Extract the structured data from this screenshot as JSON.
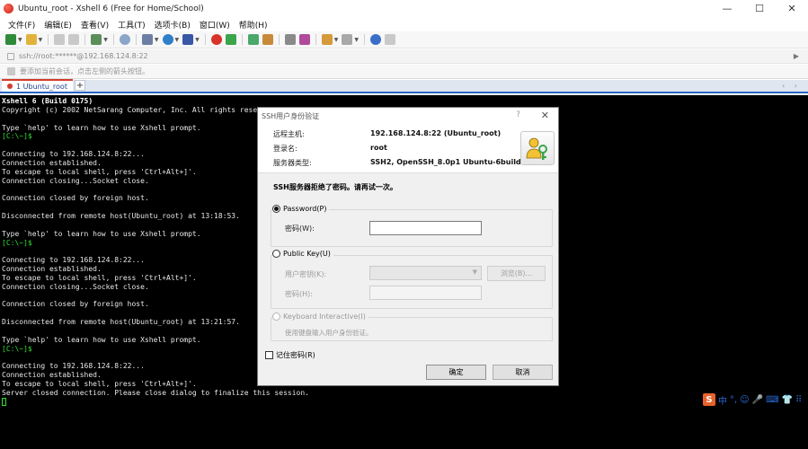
{
  "window": {
    "title": "Ubuntu_root - Xshell 6 (Free for Home/School)",
    "controls": {
      "minimize": "—",
      "maximize": "☐",
      "close": "✕"
    }
  },
  "menu": [
    "文件(F)",
    "编辑(E)",
    "查看(V)",
    "工具(T)",
    "选项卡(B)",
    "窗口(W)",
    "帮助(H)"
  ],
  "toolbar": {
    "icons": [
      "new-session-icon",
      "open-folder-icon",
      "link-icon",
      "disconnect-icon",
      "reconnect-icon",
      "search-icon",
      "properties-icon",
      "globe-icon",
      "color-icon",
      "xftp-icon",
      "xmanager-icon",
      "lock-icon",
      "keyboard-icon",
      "pen-icon",
      "script-icon",
      "layout-icon",
      "help-icon",
      "chat-icon"
    ]
  },
  "address": {
    "value": "ssh://root:******@192.168.124.8:22"
  },
  "hint": {
    "text": "要添加当前会话，点击左侧的箭头按钮。"
  },
  "tabs": [
    {
      "label": "1 Ubuntu_root",
      "active": true
    }
  ],
  "tab_add": "+",
  "tab_nav": "‹ ›",
  "terminal": {
    "lines": [
      {
        "text": "Xshell 6 (Build 0175)",
        "style": "bold"
      },
      {
        "text": "Copyright (c) 2002 NetSarang Computer, Inc. All rights reserved.",
        "style": "normal"
      },
      {
        "text": "",
        "style": "normal"
      },
      {
        "text": "Type `help' to learn how to use Xshell prompt.",
        "style": "normal"
      },
      {
        "text": "[C:\\~]$",
        "style": "prompt"
      },
      {
        "text": "",
        "style": "normal"
      },
      {
        "text": "Connecting to 192.168.124.8:22...",
        "style": "normal"
      },
      {
        "text": "Connection established.",
        "style": "normal"
      },
      {
        "text": "To escape to local shell, press 'Ctrl+Alt+]'.",
        "style": "normal"
      },
      {
        "text": "Connection closing...Socket close.",
        "style": "normal"
      },
      {
        "text": "",
        "style": "normal"
      },
      {
        "text": "Connection closed by foreign host.",
        "style": "normal"
      },
      {
        "text": "",
        "style": "normal"
      },
      {
        "text": "Disconnected from remote host(Ubuntu_root) at 13:18:53.",
        "style": "normal"
      },
      {
        "text": "",
        "style": "normal"
      },
      {
        "text": "Type `help' to learn how to use Xshell prompt.",
        "style": "normal"
      },
      {
        "text": "[C:\\~]$",
        "style": "prompt"
      },
      {
        "text": "",
        "style": "normal"
      },
      {
        "text": "Connecting to 192.168.124.8:22...",
        "style": "normal"
      },
      {
        "text": "Connection established.",
        "style": "normal"
      },
      {
        "text": "To escape to local shell, press 'Ctrl+Alt+]'.",
        "style": "normal"
      },
      {
        "text": "Connection closing...Socket close.",
        "style": "normal"
      },
      {
        "text": "",
        "style": "normal"
      },
      {
        "text": "Connection closed by foreign host.",
        "style": "normal"
      },
      {
        "text": "",
        "style": "normal"
      },
      {
        "text": "Disconnected from remote host(Ubuntu_root) at 13:21:57.",
        "style": "normal"
      },
      {
        "text": "",
        "style": "normal"
      },
      {
        "text": "Type `help' to learn how to use Xshell prompt.",
        "style": "normal"
      },
      {
        "text": "[C:\\~]$",
        "style": "prompt"
      },
      {
        "text": "",
        "style": "normal"
      },
      {
        "text": "Connecting to 192.168.124.8:22...",
        "style": "normal"
      },
      {
        "text": "Connection established.",
        "style": "normal"
      },
      {
        "text": "To escape to local shell, press 'Ctrl+Alt+]'.",
        "style": "normal"
      },
      {
        "text": "Server closed connection. Please close dialog to finalize this session.",
        "style": "normal"
      }
    ]
  },
  "ime": {
    "logo": "S",
    "items": [
      "中",
      "°,",
      "☺",
      "🎤",
      "⌨",
      "👕",
      "⠿"
    ]
  },
  "dialog": {
    "title": "SSH用户身份验证",
    "help": "?",
    "close": "✕",
    "info": [
      {
        "label": "远程主机:",
        "value": "192.168.124.8:22 (Ubuntu_root)"
      },
      {
        "label": "登录名:",
        "value": "root"
      },
      {
        "label": "服务器类型:",
        "value": "SSH2, OpenSSH_8.0p1 Ubuntu-6build1"
      }
    ],
    "message": "SSH服务器拒绝了密码。请再试一次。",
    "password_option": "Password(P)",
    "password_label": "密码(W):",
    "password_value": "",
    "publickey_option": "Public Key(U)",
    "user_key_label": "用户密钥(K):",
    "browse_button": "浏览(B)...",
    "passphrase_label": "密码(H):",
    "keyboard_option": "Keyboard Interactive(I)",
    "keyboard_hint": "使用键盘输入用户身份验证。",
    "remember_password": "记住密码(R)",
    "ok_button": "确定",
    "cancel_button": "取消"
  }
}
